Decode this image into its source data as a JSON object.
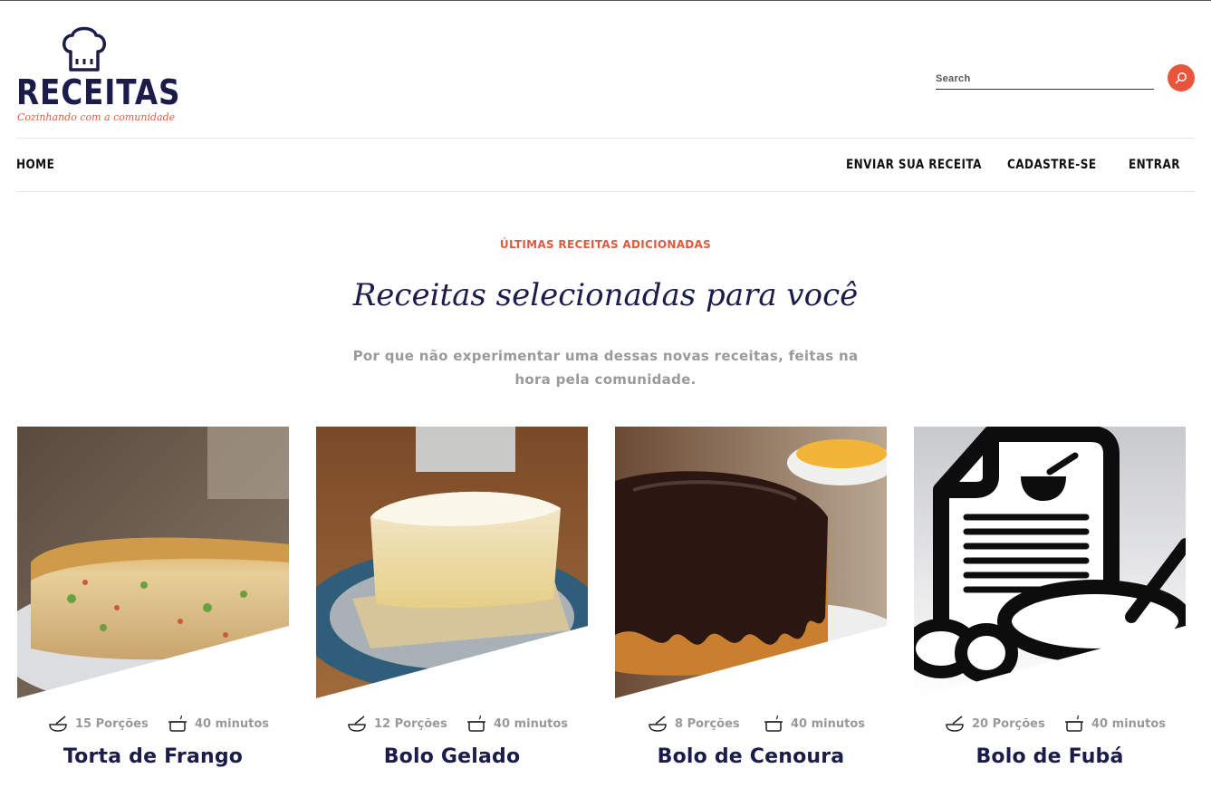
{
  "header": {
    "brand": "RECEITAS",
    "tagline": "Cozinhando com a comunidade",
    "logo_icon": "chef-hat-icon",
    "search": {
      "placeholder": "Search",
      "value": "",
      "icon": "search-icon"
    }
  },
  "nav": {
    "home": "HOME",
    "send_recipe": "ENVIAR SUA RECEITA",
    "signup": "CADASTRE-SE",
    "login": "ENTRAR"
  },
  "section": {
    "eyebrow": "ÚLTIMAS RECEITAS ADICIONADAS",
    "heading": "Receitas selecionadas para você",
    "subtitle": "Por que não experimentar uma dessas novas receitas, feitas na hora pela comunidade."
  },
  "recipes": [
    {
      "title": "Torta de Frango",
      "servings": "15 Porções",
      "time": "40 minutos",
      "image": "chicken-pie-photo"
    },
    {
      "title": "Bolo Gelado",
      "servings": "12 Porções",
      "time": "40 minutos",
      "image": "coconut-cake-photo"
    },
    {
      "title": "Bolo de Cenoura",
      "servings": "8 Porções",
      "time": "40 minutos",
      "image": "carrot-cake-photo"
    },
    {
      "title": "Bolo de Fubá",
      "servings": "20 Porções",
      "time": "40 minutos",
      "image": "recipe-document-icon"
    }
  ],
  "colors": {
    "accent": "#e8553b",
    "navy": "#1c1c4a",
    "muted": "#999999"
  }
}
